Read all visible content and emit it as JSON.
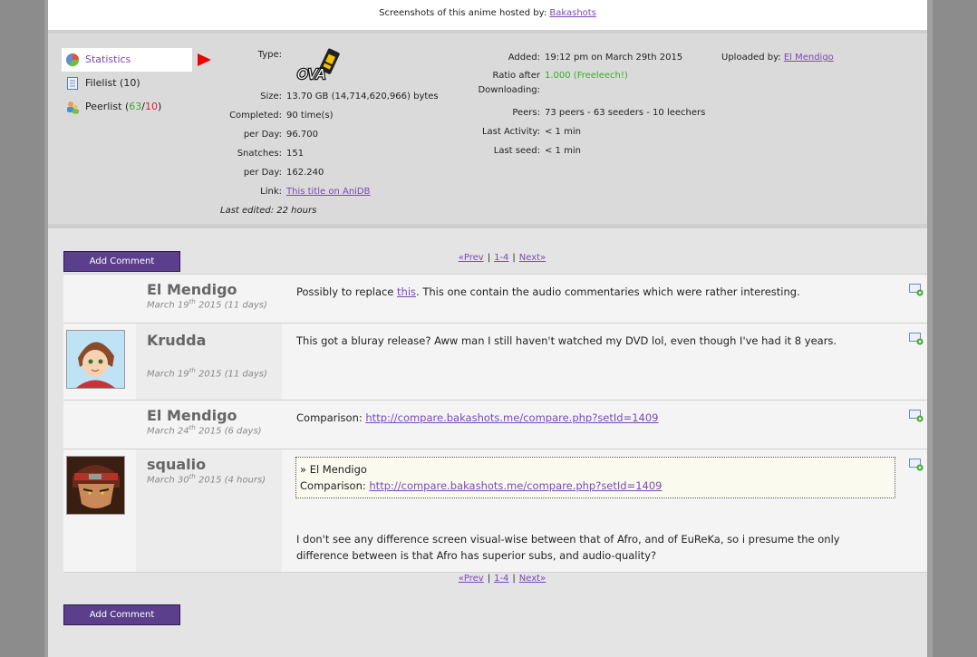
{
  "top": {
    "hosted_text": "Screenshots of this anime hosted by:",
    "hosted_link": "Bakashots"
  },
  "nav": {
    "statistics": "Statistics",
    "filelist": "Filelist (10)",
    "peerlist_prefix": "Peerlist (",
    "peer_seeders": "63",
    "peer_sep": "/",
    "peer_leechers": "10",
    "peerlist_suffix": ")"
  },
  "stats": {
    "type_label": "Type:",
    "type_value": "OVA",
    "size_label": "Size:",
    "size_value": "13.70 GB (14,714,620,966) bytes",
    "completed_label": "Completed:",
    "completed_value": "90 time(s)",
    "perday1_label": "per Day:",
    "perday1_value": "96.700",
    "snatches_label": "Snatches:",
    "snatches_value": "151",
    "perday2_label": "per Day:",
    "perday2_value": "162.240",
    "link_label": "Link:",
    "link_value": "This title on AniDB",
    "last_edited": "Last edited: 22 hours"
  },
  "stats2": {
    "added_label": "Added:",
    "added_value": "19:12 pm on March 29th 2015",
    "ratio_label1": "Ratio after",
    "ratio_label2": "Downloading:",
    "ratio_value": "1.000 (Freeleech!)",
    "peers_label": "Peers:",
    "peers_value": "73 peers - 63 seeders - 10 leechers",
    "activity_label": "Last Activity:",
    "activity_value": "< 1 min",
    "seed_label": "Last seed:",
    "seed_value": "< 1 min",
    "uploaded_label": "Uploaded by:",
    "uploaded_value": "El Mendigo"
  },
  "buttons": {
    "add_comment": "Add Comment"
  },
  "pager": {
    "prev": "«Prev",
    "range": "1-4",
    "next": "Next»",
    "pipe": "|"
  },
  "comments": [
    {
      "user": "El Mendigo",
      "date_day": "March 19",
      "date_suffix": "th",
      "date_rest": " 2015 (11 days)",
      "text_before": "Possibly to replace ",
      "text_link": "this",
      "text_after": ". This one contain the audio commentaries which were rather interesting."
    },
    {
      "user": "Krudda",
      "date_day": "March 19",
      "date_suffix": "th",
      "date_rest": " 2015 (11 days)",
      "text": "This got a bluray release? Aww man I still haven't watched my DVD lol, even though I've had it 8 years."
    },
    {
      "user": "El Mendigo",
      "date_day": "March 24",
      "date_suffix": "th",
      "date_rest": " 2015 (6 days)",
      "text_before": "Comparison: ",
      "text_link": "http://compare.bakashots.me/compare.php?setId=1409"
    },
    {
      "user": "squalio",
      "date_day": "March 30",
      "date_suffix": "th",
      "date_rest": " 2015 (4 hours)",
      "quote_author": "» El Mendigo",
      "quote_before": "Comparison: ",
      "quote_link": "http://compare.bakashots.me/compare.php?setId=1409",
      "text": "I don't see any difference screen visual-wise between that of Afro, and of EuReKa, so i presume the only difference between is that Afro has superior subs, and audio-quality?"
    }
  ],
  "colors": {
    "accent": "#7a49b6",
    "button": "#5b3f8c",
    "green": "#3aaa2a",
    "red": "#dd2233",
    "arrow": "#ee0000"
  }
}
